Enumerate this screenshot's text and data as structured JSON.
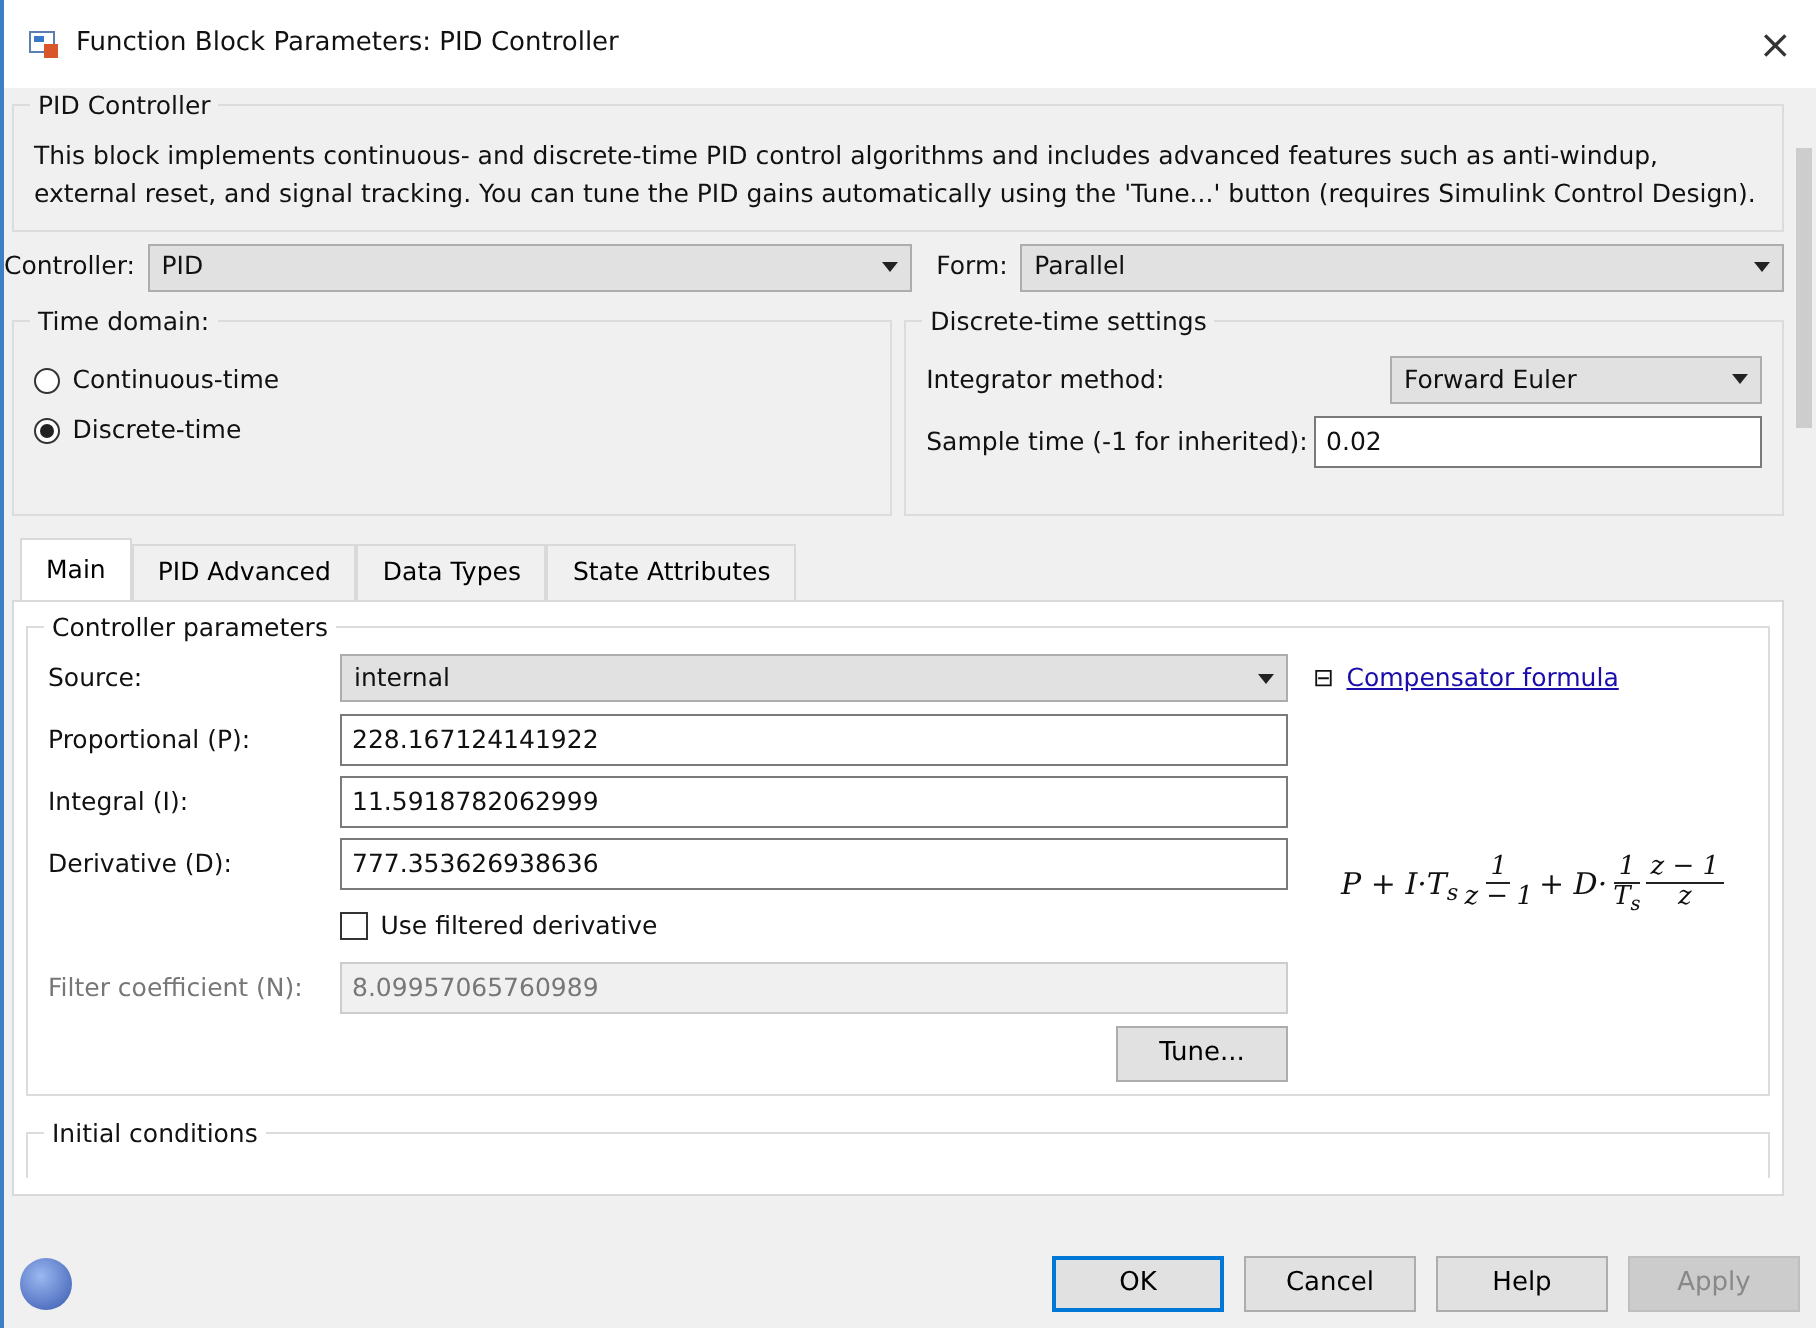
{
  "window": {
    "title": "Function Block Parameters: PID Controller",
    "close": "×"
  },
  "description": {
    "title": "PID Controller",
    "text": "This block implements continuous- and discrete-time PID control algorithms and includes advanced features such as anti-windup, external reset, and signal tracking. You can tune the PID gains automatically using the 'Tune...' button (requires Simulink Control Design)."
  },
  "controller": {
    "label": "Controller:",
    "value": "PID"
  },
  "form": {
    "label": "Form:",
    "value": "Parallel"
  },
  "time_domain": {
    "title": "Time domain:",
    "options": [
      {
        "label": "Continuous-time",
        "selected": false
      },
      {
        "label": "Discrete-time",
        "selected": true
      }
    ]
  },
  "discrete_settings": {
    "title": "Discrete-time settings",
    "integrator_label": "Integrator method:",
    "integrator_value": "Forward Euler",
    "sample_label": "Sample time (-1 for inherited):",
    "sample_value": "0.02"
  },
  "tabs": [
    {
      "label": "Main",
      "selected": true
    },
    {
      "label": "PID Advanced",
      "selected": false
    },
    {
      "label": "Data Types",
      "selected": false
    },
    {
      "label": "State Attributes",
      "selected": false
    }
  ],
  "controller_parameters": {
    "title": "Controller parameters",
    "fields": [
      {
        "kind": "select",
        "label": "Source:",
        "value": "internal"
      },
      {
        "kind": "text",
        "label": "Proportional (P):",
        "value": "228.167124141922",
        "disabled": false
      },
      {
        "kind": "text",
        "label": "Integral (I):",
        "value": "11.5918782062999",
        "disabled": false
      },
      {
        "kind": "text",
        "label": "Derivative (D):",
        "value": "777.353626938636",
        "disabled": false
      },
      {
        "kind": "checkbox",
        "label": "Use filtered derivative",
        "checked": false
      },
      {
        "kind": "text",
        "label": "Filter coefficient (N):",
        "value": "8.09957065760989",
        "disabled": true
      }
    ],
    "tune_button": "Tune...",
    "formula_toggle": {
      "symbol": "⊟",
      "expanded": true
    },
    "formula_link": "Compensator formula",
    "formula": [
      {
        "kind": "text",
        "text": "P + I·T$_{s}$"
      },
      {
        "kind": "fraction",
        "numerator": "1",
        "denominator": "z − 1"
      },
      {
        "kind": "text",
        "text": "+ D·"
      },
      {
        "kind": "fraction",
        "numerator": "1",
        "denominator": "T$_{s}$"
      },
      {
        "kind": "fraction",
        "numerator": "z − 1",
        "denominator": "z"
      }
    ]
  },
  "initial_conditions": {
    "title": "Initial conditions"
  },
  "buttons": [
    {
      "label": "OK",
      "disabled": false,
      "default": true
    },
    {
      "label": "Cancel",
      "disabled": false,
      "default": false
    },
    {
      "label": "Help",
      "disabled": false,
      "default": false
    },
    {
      "label": "Apply",
      "disabled": true,
      "default": false
    }
  ]
}
